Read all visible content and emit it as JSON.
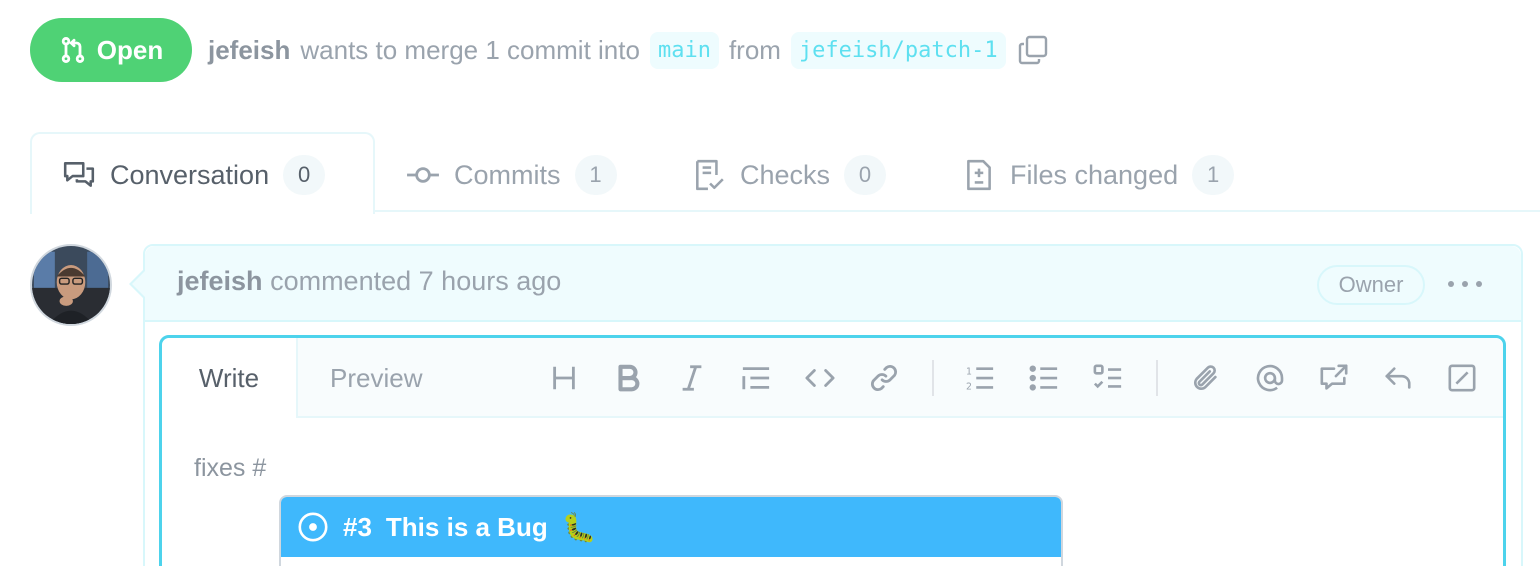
{
  "pr": {
    "state": "Open",
    "author": "jefeish",
    "merge_text": "wants to merge 1 commit into",
    "base_branch": "main",
    "from_text": "from",
    "head_branch": "jefeish/patch-1"
  },
  "tabs": [
    {
      "label": "Conversation",
      "count": "0",
      "icon": "comment-discussion-icon",
      "active": true
    },
    {
      "label": "Commits",
      "count": "1",
      "icon": "git-commit-icon",
      "active": false
    },
    {
      "label": "Checks",
      "count": "0",
      "icon": "checklist-icon",
      "active": false
    },
    {
      "label": "Files changed",
      "count": "1",
      "icon": "file-diff-icon",
      "active": false
    }
  ],
  "comment": {
    "author": "jefeish",
    "action": "commented",
    "time": "7 hours ago",
    "role": "Owner"
  },
  "editor": {
    "write_tab": "Write",
    "preview_tab": "Preview",
    "text": "fixes #",
    "toolbar_icons": [
      "heading-icon",
      "bold-icon",
      "italic-icon",
      "quote-icon",
      "code-icon",
      "link-icon",
      "ordered-list-icon",
      "unordered-list-icon",
      "task-list-icon",
      "attach-icon",
      "mention-icon",
      "cross-reference-icon",
      "reply-icon",
      "slash-command-icon"
    ]
  },
  "suggestion": {
    "number": "#3",
    "title": "This is a Bug",
    "emoji": "🐛"
  },
  "colors": {
    "open_green": "#4fd275",
    "accent_cyan": "#4dd3ec",
    "selection_blue": "#3fb8fc"
  }
}
